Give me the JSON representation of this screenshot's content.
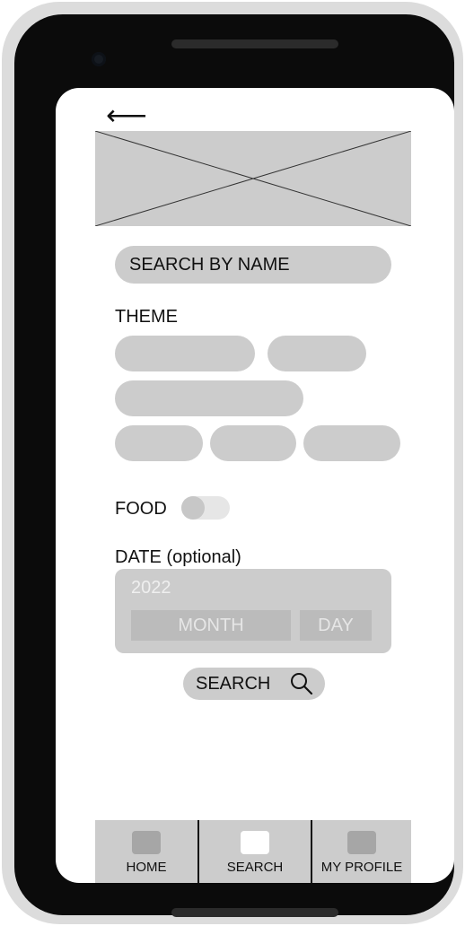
{
  "header": {
    "back_icon": "left-arrow-icon",
    "back_glyph": "⟵"
  },
  "banner": {
    "icon": "image-placeholder-icon"
  },
  "search_field": {
    "label": "SEARCH BY NAME"
  },
  "theme": {
    "label": "THEME"
  },
  "food": {
    "label": "FOOD",
    "enabled": false
  },
  "date": {
    "label": "DATE (optional)",
    "year": "2022",
    "month": "MONTH",
    "day": "DAY"
  },
  "search_button": {
    "label": "SEARCH",
    "icon": "search-icon"
  },
  "nav": {
    "items": [
      {
        "label": "HOME",
        "icon": "home-icon",
        "active": false
      },
      {
        "label": "SEARCH",
        "icon": "search-tab-icon",
        "active": true
      },
      {
        "label": "MY PROFILE",
        "icon": "profile-icon",
        "active": false
      }
    ]
  },
  "colors": {
    "control": "#cccccc",
    "nav_icon": "#a6a6a6",
    "nav_icon_active": "#ffffff",
    "frame": "#0b0b0b"
  }
}
